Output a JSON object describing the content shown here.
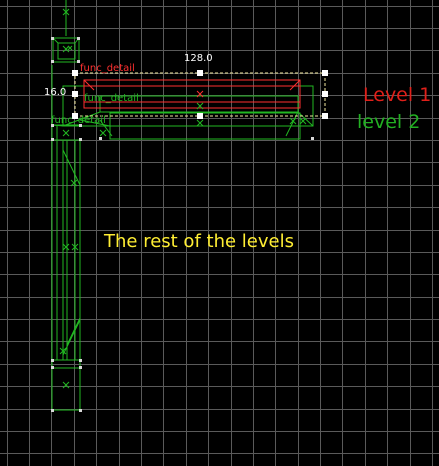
{
  "viewport": {
    "grid_color": "#5a5a5a",
    "background": "#000000",
    "colors": {
      "selected": "#ff3030",
      "selected_box": "#f2e8a0",
      "brush": "#22b822",
      "handle": "#ffffff",
      "annotation_yellow": "#ffee33",
      "annotation_red": "#e0201a",
      "annotation_green": "#22b022"
    },
    "entity_labels": [
      "func_detail",
      "func_detail",
      "func_detail"
    ],
    "width_readout": "128.0",
    "height_readout": "16.0",
    "annotations": {
      "level1": "Level 1",
      "level2": "level 2",
      "rest": "The rest of the levels"
    }
  }
}
